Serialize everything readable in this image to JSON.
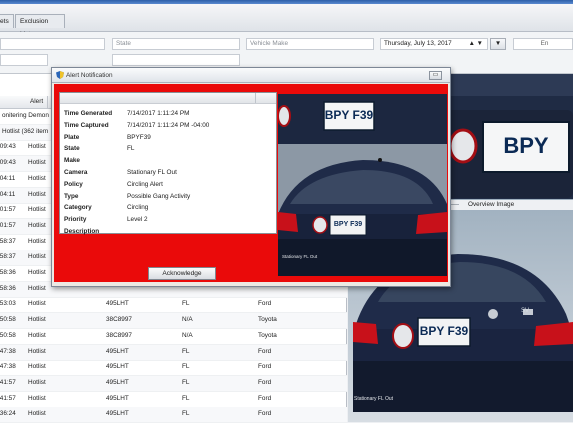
{
  "tabs": [
    {
      "label": "ets"
    },
    {
      "label": "Exclusion List"
    }
  ],
  "filters": {
    "state": "State",
    "vehicle_make": "Vehicle Make",
    "date": "Thursday, July 13, 2017",
    "end_label": "En"
  },
  "list": {
    "col_alert": "Alert",
    "rows": [
      {
        "time": "",
        "type": "onitering Demon"
      },
      {
        "time": "",
        "type": "Hotlist (362 item"
      },
      {
        "time": ":09:43",
        "type": "Hotlist",
        "plate": "",
        "state": "",
        "make": ""
      },
      {
        "time": ":09:43",
        "type": "Hotlist",
        "plate": "",
        "state": "",
        "make": ""
      },
      {
        "time": ":04:11",
        "type": "Hotlist",
        "plate": "",
        "state": "",
        "make": ""
      },
      {
        "time": ":04:11",
        "type": "Hotlist",
        "plate": "",
        "state": "",
        "make": ""
      },
      {
        "time": ":01:57",
        "type": "Hotlist",
        "plate": "",
        "state": "",
        "make": ""
      },
      {
        "time": ":01:57",
        "type": "Hotlist",
        "plate": "",
        "state": "",
        "make": ""
      },
      {
        "time": ":58:37",
        "type": "Hotlist",
        "plate": "",
        "state": "",
        "make": ""
      },
      {
        "time": ":58:37",
        "type": "Hotlist",
        "plate": "",
        "state": "",
        "make": ""
      },
      {
        "time": ":58:36",
        "type": "Hotlist",
        "plate": "",
        "state": "",
        "make": ""
      },
      {
        "time": ":58:36",
        "type": "Hotlist",
        "plate": "",
        "state": "",
        "make": ""
      },
      {
        "time": ":53:03",
        "type": "Hotlist",
        "plate": "495LHT",
        "state": "FL",
        "make": "Ford"
      },
      {
        "time": ":50:58",
        "type": "Hotlist",
        "plate": "38C8997",
        "state": "N/A",
        "make": "Toyota"
      },
      {
        "time": ":50:58",
        "type": "Hotlist",
        "plate": "38C8997",
        "state": "N/A",
        "make": "Toyota"
      },
      {
        "time": ":47:38",
        "type": "Hotlist",
        "plate": "495LHT",
        "state": "FL",
        "make": "Ford"
      },
      {
        "time": ":47:38",
        "type": "Hotlist",
        "plate": "495LHT",
        "state": "FL",
        "make": "Ford"
      },
      {
        "time": ":41:57",
        "type": "Hotlist",
        "plate": "495LHT",
        "state": "FL",
        "make": "Ford"
      },
      {
        "time": ":41:57",
        "type": "Hotlist",
        "plate": "495LHT",
        "state": "FL",
        "make": "Ford"
      },
      {
        "time": ":36:24",
        "type": "Hotlist",
        "plate": "495LHT",
        "state": "FL",
        "make": "Ford"
      }
    ]
  },
  "overview": {
    "label": "Overview Image",
    "caption": "Stationary FL Out",
    "plate": "BPY F39"
  },
  "dialog": {
    "title": "Alert Notification",
    "fields": [
      {
        "label": "Time Generated",
        "value": "7/14/2017 1:11:24 PM"
      },
      {
        "label": "Time Captured",
        "value": "7/14/2017 1:11:24 PM -04:00"
      },
      {
        "label": "Plate",
        "value": "BPYF39"
      },
      {
        "label": "State",
        "value": "FL"
      },
      {
        "label": "Make",
        "value": ""
      },
      {
        "label": "Camera",
        "value": "Stationary FL Out"
      },
      {
        "label": "Policy",
        "value": "Circling Alert"
      },
      {
        "label": "Type",
        "value": "Possible Gang Activity"
      },
      {
        "label": "Category",
        "value": "Circling"
      },
      {
        "label": "Priority",
        "value": "Level 2"
      },
      {
        "label": "Description",
        "value": ""
      }
    ],
    "acknowledge": "Acknowledge",
    "thumb_plate": "BPY F39",
    "thumb_caption": "Stationary FL Out"
  },
  "colors": {
    "alert_red": "#ea0a0a",
    "title_blue": "#2c5fa8",
    "car_navy": "#1e2a44"
  }
}
